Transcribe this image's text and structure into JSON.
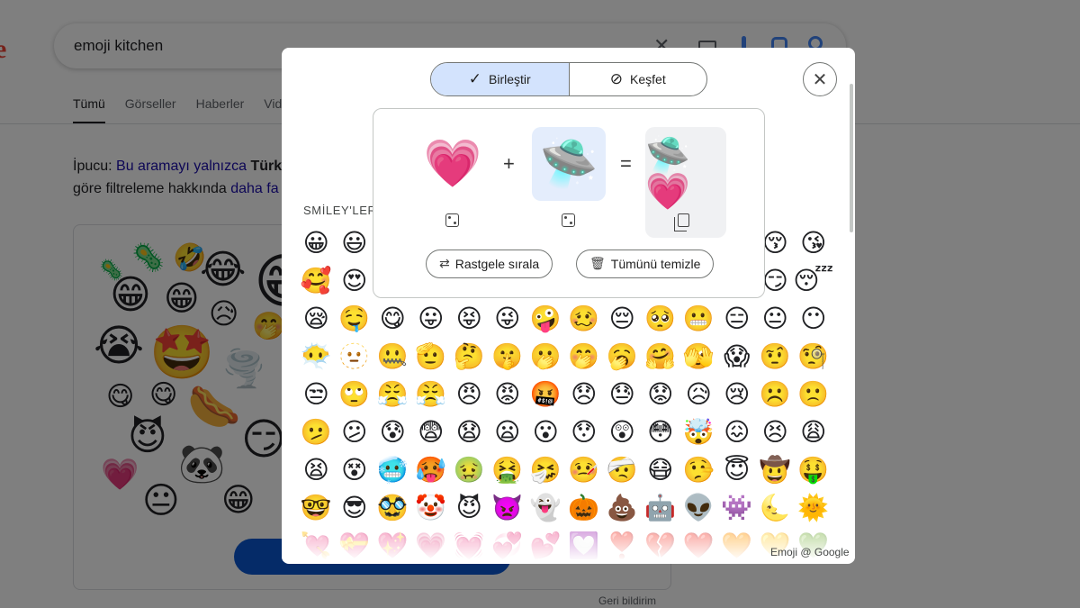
{
  "search": {
    "query": "emoji kitchen"
  },
  "tabs": [
    {
      "label": "Tümü"
    },
    {
      "label": "Görseller"
    },
    {
      "label": "Haberler"
    },
    {
      "label": "Vid"
    }
  ],
  "tip": {
    "prefix": "İpucu: ",
    "link1": "Bu aramayı yalnızca",
    "bold": "Türk",
    "line2_prefix": "göre filtreleme hakkında ",
    "link2": "daha fa"
  },
  "collage": [
    "🦠",
    "🤣",
    "😂",
    "😁",
    "😁",
    "😥",
    "😭",
    "🤩",
    "🌪️",
    "🤭",
    "😋",
    "🌭",
    "😈",
    "🐼",
    "💗",
    "😐",
    "😁",
    "😏"
  ],
  "feedback": "Geri bildirim",
  "modal": {
    "segments": {
      "combine_label": "Birleştir",
      "explore_label": "Keşfet"
    },
    "combiner": {
      "left_emoji": "💗",
      "right_emoji": "🛸",
      "result_emoji": "🛸💗",
      "plus": "+",
      "equals": "=",
      "shuffle_label": "Rastgele sırala",
      "clear_label": "Tümünü temizle"
    },
    "section_title": "SMİLEY'LER",
    "attribution": "Emoji @ Google",
    "emoji_rows": [
      [
        "😀",
        "😃",
        "😄",
        "😁",
        "😆",
        "😅",
        "🤣",
        "😂",
        "🙂",
        "🙃",
        "😉",
        "😊",
        "😚",
        "😘"
      ],
      [
        "🥰",
        "😍",
        "🤩",
        "😗",
        "☺️",
        "😙",
        "😋",
        "😛",
        "😜",
        "🤪",
        "😝",
        "🤑",
        "😏",
        "😴"
      ],
      [
        "😪",
        "🤤",
        "😋",
        "😛",
        "😝",
        "😜",
        "🤪",
        "🥴",
        "😔",
        "🥺",
        "😬",
        "😑",
        "😐",
        "😶"
      ],
      [
        "😶‍🌫️",
        "🫥",
        "🤐",
        "🫡",
        "🤔",
        "🤫",
        "🫢",
        "🤭",
        "🥱",
        "🤗",
        "🫣",
        "😱",
        "🤨",
        "🧐"
      ],
      [
        "😒",
        "🙄",
        "😤",
        "😤",
        "😠",
        "😡",
        "🤬",
        "😞",
        "😓",
        "😟",
        "😥",
        "😢",
        "☹️",
        "🙁"
      ],
      [
        "🫤",
        "😕",
        "😰",
        "😨",
        "😧",
        "😦",
        "😮",
        "😯",
        "😲",
        "😳",
        "🤯",
        "😖",
        "😣",
        "😩"
      ],
      [
        "😫",
        "😵",
        "🥶",
        "🥵",
        "🤢",
        "🤮",
        "🤧",
        "🤒",
        "🤕",
        "😷",
        "🤥",
        "😇",
        "🤠",
        "🤑"
      ],
      [
        "🤓",
        "😎",
        "🥸",
        "🤡",
        "😈",
        "👿",
        "👻",
        "🎃",
        "💩",
        "🤖",
        "👽",
        "👾",
        "🌜",
        "🌞"
      ],
      [
        "💘",
        "💝",
        "💖",
        "💗",
        "💓",
        "💞",
        "💕",
        "💟",
        "❣️",
        "💔",
        "❤️",
        "🧡",
        "💛",
        "💚"
      ]
    ]
  }
}
